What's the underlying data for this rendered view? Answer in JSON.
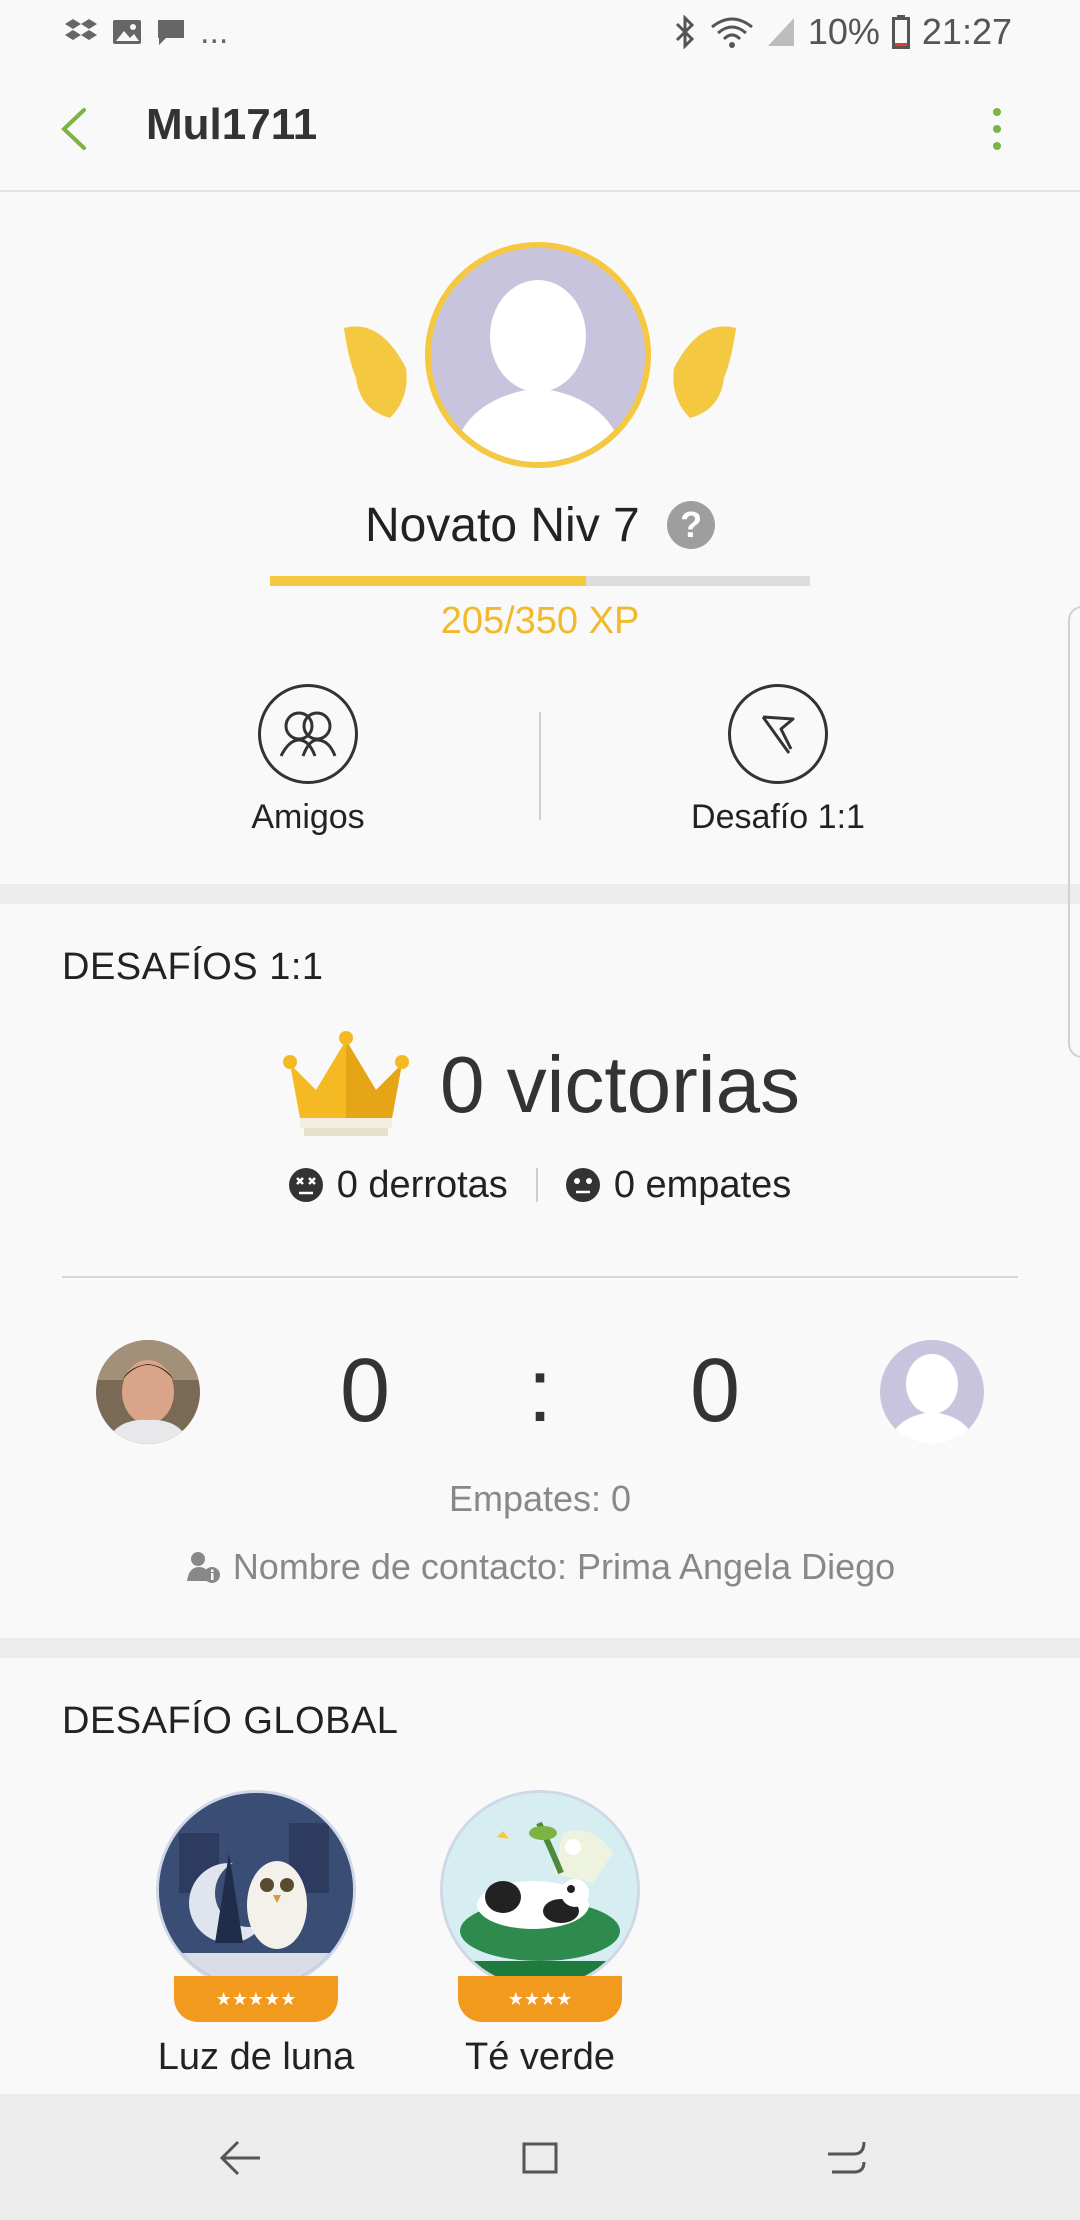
{
  "status_bar": {
    "left_icons": [
      "dropbox-icon",
      "image-icon",
      "message-icon",
      "more-dots"
    ],
    "more_text": "...",
    "battery": "10%",
    "time": "21:27"
  },
  "app_bar": {
    "title": "Mul1711",
    "accent": "#7cb342"
  },
  "profile": {
    "level_text": "Novato Niv 7",
    "help_icon": "?",
    "xp_text": "205/350 XP",
    "xp_progress": 0.586,
    "actions": [
      {
        "label": "Amigos",
        "icon": "friends-icon"
      },
      {
        "label": "Desafío 1:1",
        "icon": "flag-icon"
      }
    ]
  },
  "challenges": {
    "title": "DESAFÍOS 1:1",
    "wins": "0 victorias",
    "defeats": "0 derrotas",
    "ties": "0 empates",
    "score_left": "0",
    "score_sep": ":",
    "score_right": "0",
    "empates": "Empates: 0",
    "contact": "Nombre de contacto: Prima Angela Diego"
  },
  "global": {
    "title": "DESAFÍO GLOBAL",
    "items": [
      {
        "label": "Luz de luna",
        "stars": "★★★★★"
      },
      {
        "label": "Té verde",
        "stars": "★★★★"
      }
    ]
  }
}
